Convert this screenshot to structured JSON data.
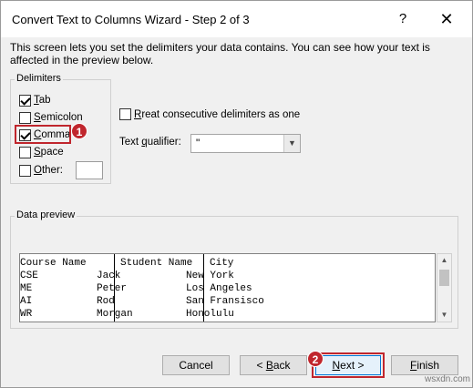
{
  "window": {
    "title": "Convert Text to Columns Wizard - Step 2 of 3",
    "help_glyph": "?",
    "close_glyph": "✕"
  },
  "description": "This screen lets you set the delimiters your data contains.  You can see how your text is affected in the preview below.",
  "delimiters": {
    "group_title": "Delimiters",
    "tab": {
      "mnemonic": "T",
      "rest": "ab",
      "checked": true
    },
    "semicolon": {
      "mnemonic": "S",
      "rest": "emicolon",
      "checked": false
    },
    "comma": {
      "mnemonic": "C",
      "rest": "omma",
      "checked": true
    },
    "space": {
      "mnemonic": "S",
      "rest": "pace",
      "checked": false
    },
    "other": {
      "mnemonic": "O",
      "rest": "ther:",
      "checked": false,
      "value": ""
    }
  },
  "consecutive": {
    "pre": "",
    "mnemonic": "R",
    "rest": "reat consecutive delimiters as one",
    "checked": false
  },
  "text_qualifier": {
    "pre": "Text ",
    "mnemonic": "q",
    "rest": "ualifier:",
    "value": "\""
  },
  "data_preview": {
    "group_title": "Data preview",
    "headers": [
      "Course Name",
      "Student Name",
      "City"
    ],
    "rows": [
      [
        "CSE",
        "Jack",
        "New York"
      ],
      [
        "ME",
        "Peter",
        "Los Angeles"
      ],
      [
        "AI",
        "Rod",
        "San Fransisco"
      ],
      [
        "WR",
        "Morgan",
        "Honolulu"
      ]
    ]
  },
  "buttons": {
    "cancel": "Cancel",
    "back": {
      "pre": "< ",
      "mnemonic": "B",
      "rest": "ack"
    },
    "next": {
      "mnemonic": "N",
      "rest": "ext >"
    },
    "finish": {
      "mnemonic": "F",
      "rest": "inish"
    }
  },
  "annotations": {
    "badge_1": "1",
    "badge_2": "2",
    "highlight_color": "#c0262d"
  },
  "watermark": "wsxdn.com"
}
